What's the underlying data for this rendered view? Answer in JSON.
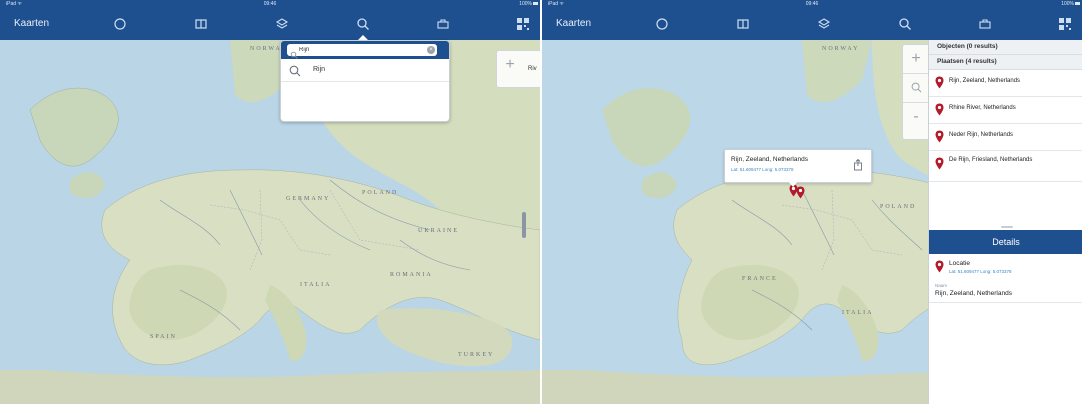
{
  "left": {
    "status": {
      "carrier": "iPad ᯤ",
      "time": "09:46",
      "battery": "100%"
    },
    "nav": {
      "title": "Kaarten",
      "icons": [
        "circle-icon",
        "book-icon",
        "layers-icon",
        "search-icon",
        "toolbox-icon",
        "qr-icon"
      ],
      "active": "search-icon"
    },
    "search": {
      "query": "Rijn",
      "suggestion": "Rijn"
    },
    "map_labels": [
      "NORWAY",
      "UKRAINE",
      "POLAND",
      "GERMANY",
      "ITALIA",
      "TURKEY",
      "SPAIN",
      "ROMANIA"
    ],
    "map_edge_label": "Riv"
  },
  "right": {
    "status": {
      "carrier": "iPad ᯤ",
      "time": "09:46",
      "battery": "100%"
    },
    "nav": {
      "title": "Kaarten"
    },
    "callout": {
      "title": "Rijn, Zeeland, Netherlands",
      "coord": "Lat: 51.609477 Long: 5.073378"
    },
    "panel": {
      "objects_header": "Objecten (0 results)",
      "places_header": "Plaatsen (4 results)",
      "results": [
        "Rijn, Zeeland, Netherlands",
        "Rhine River, Netherlands",
        "Neder Rijn, Netherlands",
        "De Rijn, Friesland, Netherlands"
      ],
      "details_title": "Details",
      "location_label": "Locatie",
      "location_coord": "Lat: 51.609477 Long: 5.073378",
      "name_label": "Naam",
      "name_value": "Rijn, Zeeland, Netherlands"
    },
    "map_labels": [
      "NORWAY",
      "POLAND",
      "FRANCE",
      "ITALIA"
    ]
  },
  "colors": {
    "navbar": "#1e4f8e",
    "marker": "#b31b2b",
    "link": "#3a87c8"
  }
}
